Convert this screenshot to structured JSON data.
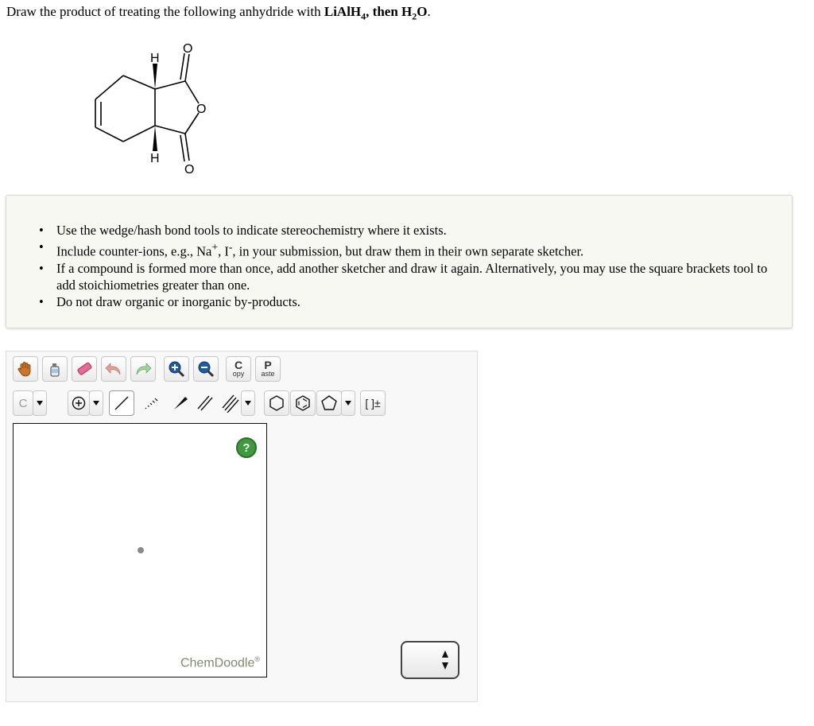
{
  "question": {
    "prefix": "Draw the product of treating the following anhydride with ",
    "reagent_base": "LiAlH",
    "reagent_sub": "4",
    "then": ", then H",
    "water_sub": "2",
    "water_end": "O",
    "end": "."
  },
  "molecule": {
    "labels": {
      "h_top": "H",
      "h_bottom": "H",
      "o_top": "O",
      "o_ring": "O",
      "o_bottom": "O"
    }
  },
  "instructions": [
    {
      "id": "stereo",
      "text": "Use the wedge/hash bond tools to indicate stereochemistry where it exists."
    },
    {
      "id": "counterions",
      "before": "Include counter-ions, e.g., Na",
      "sup1": "+",
      "mid": ", I",
      "sup2": "-",
      "after": ", in your submission, but draw them in their own separate sketcher."
    },
    {
      "id": "repeat",
      "text": "If a compound is formed more than once, add another sketcher and draw it again. Alternatively, you may use the square brackets tool to add stoichiometries greater than one."
    },
    {
      "id": "byproducts",
      "text": "Do not draw organic or inorganic by-products."
    }
  ],
  "sketcher": {
    "toolbar1": {
      "copy_big": "C",
      "copy_small": "opy",
      "paste_big": "P",
      "paste_small": "aste"
    },
    "toolbar2": {
      "element_label": "C",
      "brackets_label": "[ ]±"
    },
    "help_label": "?",
    "watermark": "ChemDoodle",
    "watermark_mark": "®",
    "icons": [
      "hand-icon",
      "clear-icon",
      "eraser-icon",
      "undo-icon",
      "redo-icon",
      "zoom-in-icon",
      "zoom-out-icon",
      "charge-plus-icon",
      "single-bond-icon",
      "hash-bond-icon",
      "wedge-bond-icon",
      "double-bond-icon",
      "triple-bond-icon",
      "cyclohexane-icon",
      "benzene-icon",
      "cyclopentane-icon"
    ]
  },
  "colors": {
    "help_green": "#3f9a3f",
    "panel_bg": "#f8f8f2",
    "watermark": "#7a8c6a"
  }
}
